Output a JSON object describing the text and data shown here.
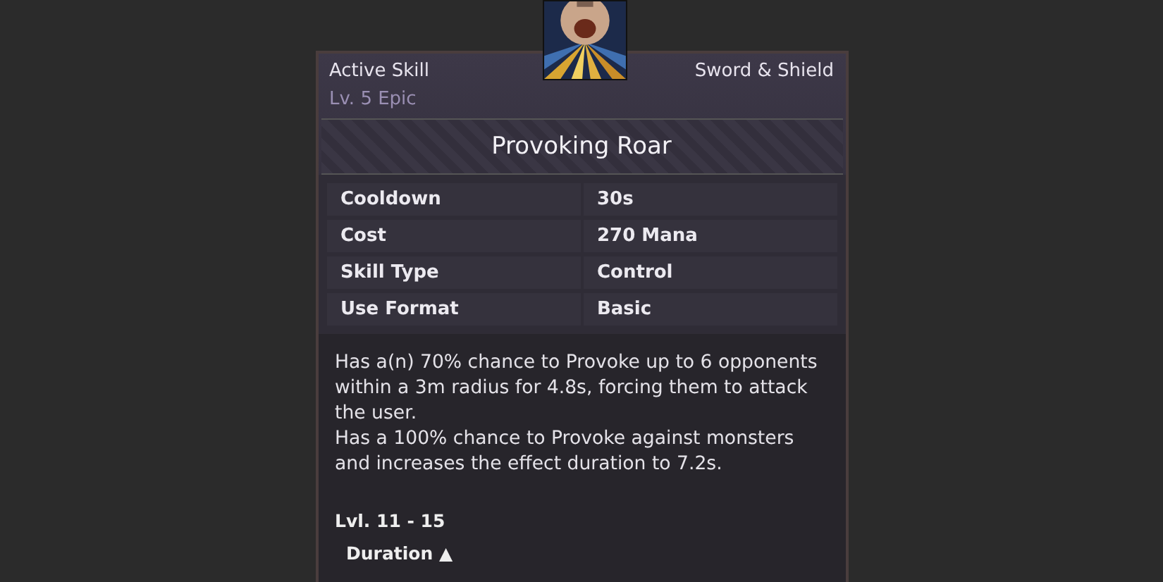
{
  "skill": {
    "kind_label": "Active Skill",
    "weapon": "Sword & Shield",
    "level": "Lv. 5 Epic",
    "name": "Provoking Roar",
    "stats": [
      {
        "label": "Cooldown",
        "value": "30s"
      },
      {
        "label": "Cost",
        "value": "270 Mana"
      },
      {
        "label": "Skill Type",
        "value": "Control"
      },
      {
        "label": "Use Format",
        "value": "Basic"
      }
    ],
    "description": [
      "Has a(n) 70% chance to Provoke up to 6 opponents within a 3m radius for 4.8s, forcing them to attack the user.",
      "Has a 100% chance to Provoke against monsters and increases the effect duration to 7.2s."
    ],
    "level_range": "Lvl. 11 - 15",
    "upgrade": "Duration ▲"
  }
}
